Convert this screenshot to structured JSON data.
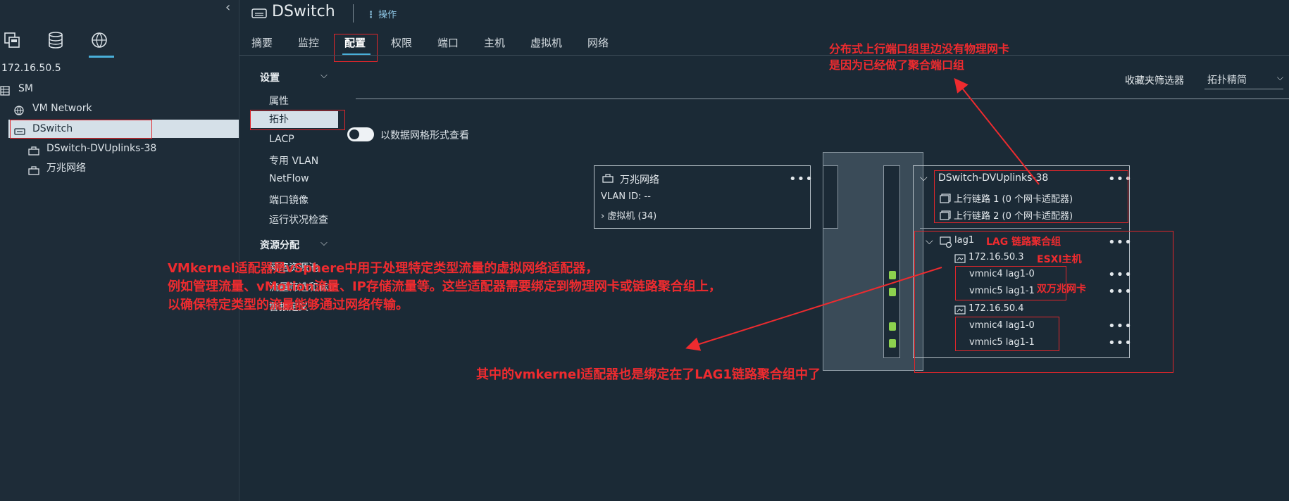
{
  "window": {
    "title": "DSwitch",
    "actions_label": "操作"
  },
  "sidebar": {
    "collapse_label": "‹",
    "host_ip": "172.16.50.5",
    "tree": [
      {
        "label": "SM",
        "icon": "datacenter-icon"
      },
      {
        "label": "VM Network",
        "icon": "network-icon"
      },
      {
        "label": "DSwitch",
        "icon": "dvswitch-icon"
      },
      {
        "label": "DSwitch-DVUplinks-38",
        "icon": "portgroup-icon"
      },
      {
        "label": "万兆网络",
        "icon": "portgroup-icon"
      }
    ]
  },
  "nav_tabs": [
    "摘要",
    "监控",
    "配置",
    "权限",
    "端口",
    "主机",
    "虚拟机",
    "网络"
  ],
  "settings": {
    "section1": "设置",
    "items": [
      "属性",
      "拓扑",
      "LACP",
      "专用 VLAN",
      "NetFlow",
      "端口镜像",
      "运行状况检查"
    ],
    "section2": "资源分配",
    "items2": [
      "网络资源池",
      "流量筛选和标记",
      "警报定义"
    ]
  },
  "filter": {
    "label": "收藏夹筛选器",
    "value": "拓扑精简"
  },
  "grid_toggle_label": "以数据网格形式查看",
  "topology": {
    "portgroup": {
      "name": "万兆网络",
      "vlan": "VLAN ID: --",
      "vms": "虚拟机 (34)"
    },
    "uplinks": {
      "name": "DSwitch-DVUplinks-38",
      "uplink1": "上行链路 1 (0 个网卡适配器)",
      "uplink2": "上行链路 2 (0 个网卡适配器)"
    },
    "lag": {
      "name": "lag1",
      "hosts": [
        {
          "ip": "172.16.50.3",
          "nics": [
            "vmnic4 lag1-0",
            "vmnic5 lag1-1"
          ]
        },
        {
          "ip": "172.16.50.4",
          "nics": [
            "vmnic4 lag1-0",
            "vmnic5 lag1-1"
          ]
        }
      ]
    },
    "more_label": "•••"
  },
  "annotations": {
    "uplink_note_1": "分布式上行端口组里边没有物理网卡",
    "uplink_note_2": "是因为已经做了聚合端口组",
    "lag_note": "LAG  链路聚合组",
    "esxi_note": "ESXI主机",
    "nic_note": "双万兆网卡",
    "vmk_line1": "VMkernel适配器是vSphere中用于处理特定类型流量的虚拟网络适配器，",
    "vmk_line2": "例如管理流量、vMotion流量、IP存储流量等。这些适配器需要绑定到物理网卡或链路聚合组上，",
    "vmk_line3": "以确保特定类型的流量能够通过网络传输。",
    "bottom_note": "其中的vmkernel适配器也是绑定在了LAG1链路聚合组中了"
  },
  "colors": {
    "background": "#1b2a36",
    "accent": "#49afd9",
    "annotation": "#ee2b2f",
    "selected": "#d5e0e8",
    "port": "#8cd14e"
  }
}
